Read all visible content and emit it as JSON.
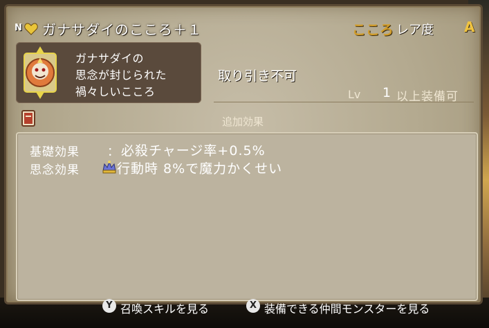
{
  "title": {
    "grade_mark": "N",
    "name": "ガナサダイのこころ＋１",
    "type": "こころ",
    "rarity_label": "レア度",
    "rarity_value": "A"
  },
  "description": {
    "lines": [
      "ガナサダイの",
      "思念が封じられた",
      "禍々しいこころ"
    ]
  },
  "trade": "取り引き不可",
  "level": {
    "label": "Lv",
    "value": "1",
    "suffix": "以上装備可"
  },
  "extra_effects_label": "追加効果",
  "effects": [
    {
      "label": "基礎効果",
      "separator": "：",
      "value": "必殺チャージ率+0.5%"
    },
    {
      "label": "思念効果",
      "separator": "",
      "value": "行動時 8%で魔力かくせい"
    }
  ],
  "footer": {
    "y_key": "Y",
    "y_label": "召喚スキルを見る",
    "x_key": "X",
    "x_label": "装備できる仲間モンスターを見る"
  },
  "colors": {
    "accent_gold": "#d29d2a",
    "rarity_gold": "#f1c440",
    "panel_dark": "#5a4a3c"
  }
}
